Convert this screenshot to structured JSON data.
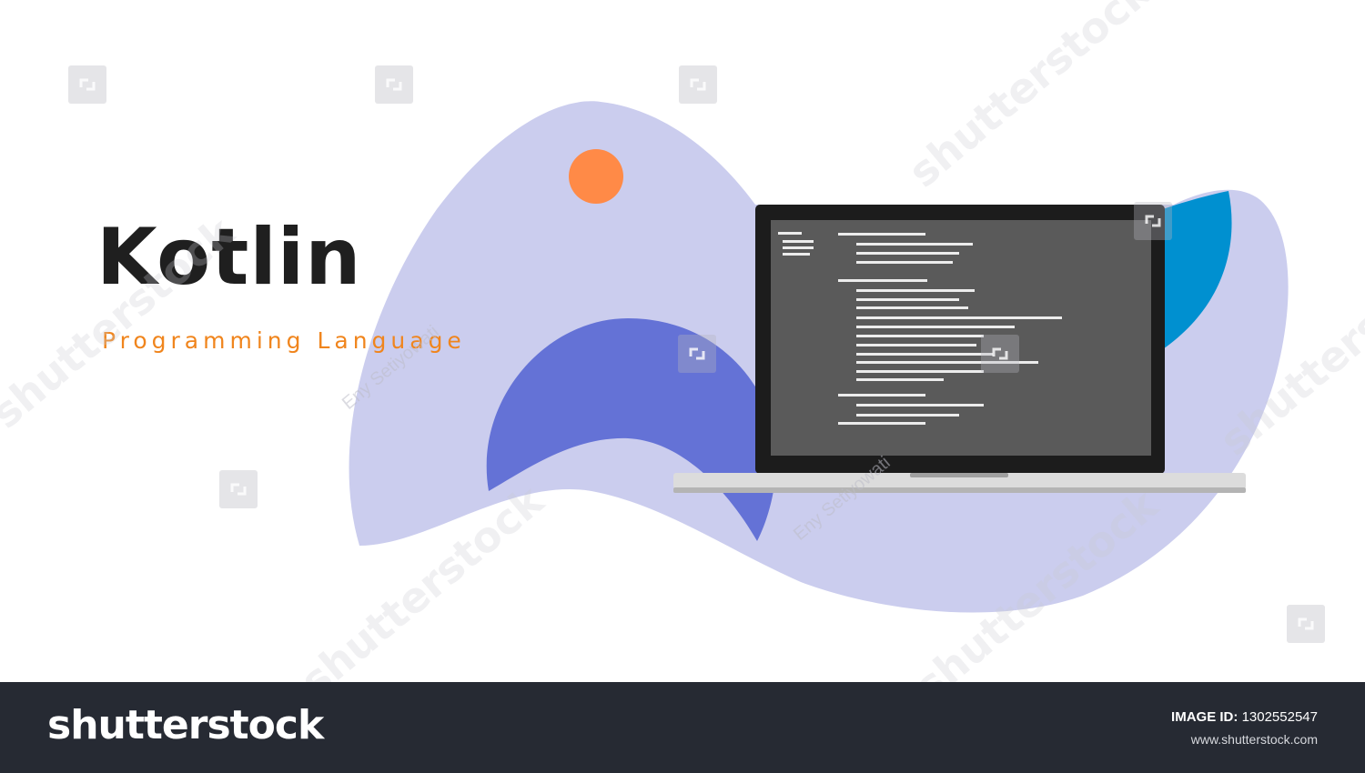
{
  "headline": "Kotlin",
  "subline": "Programming Language",
  "colors": {
    "blob_light": "#cbcdee",
    "wave_indigo": "#6472d6",
    "sun_orange": "#ff8a47",
    "accent_blue": "#0090d0",
    "screen": "#5a5a5a",
    "laptop_frame": "#1c1c1c",
    "laptop_base": "#d9d9d9",
    "headline": "#1f1f1f",
    "subline": "#f0851d",
    "footer_bg": "#262a33"
  },
  "icons": [
    "orange-sun-icon",
    "laptop-icon",
    "code-lines-icon",
    "shutterstock-watermark-icon"
  ],
  "watermark": {
    "brand": "shutterstock",
    "credit": "Eny Setiyowati"
  },
  "footer": {
    "logo": "shutterstock",
    "image_id_label": "IMAGE ID:",
    "image_id": "1302552547",
    "url": "www.shutterstock.com"
  }
}
